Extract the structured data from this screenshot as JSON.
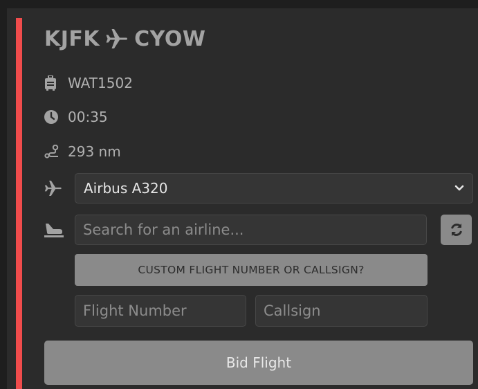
{
  "flight": {
    "origin": "KJFK",
    "destination": "CYOW",
    "flight_number": "WAT1502",
    "duration": "00:35",
    "distance": "293 nm"
  },
  "form": {
    "aircraft_selected": "Airbus A320",
    "airline_placeholder": "Search for an airline...",
    "custom_button_label": "CUSTOM FLIGHT NUMBER OR CALLSIGN?",
    "flight_number_placeholder": "Flight Number",
    "callsign_placeholder": "Callsign",
    "bid_button_label": "Bid Flight"
  },
  "icons": {
    "route_arrow": "plane-icon",
    "flight_number": "luggage-icon",
    "duration": "clock-icon",
    "distance": "route-icon",
    "aircraft": "plane-icon",
    "airline": "plane-departure-icon",
    "refresh": "refresh-icon",
    "dropdown": "chevron-down-icon"
  },
  "colors": {
    "accent": "#f04c4c",
    "card_background": "#2b2b2b",
    "button_background": "#8a8a8a",
    "input_background": "#353535"
  }
}
